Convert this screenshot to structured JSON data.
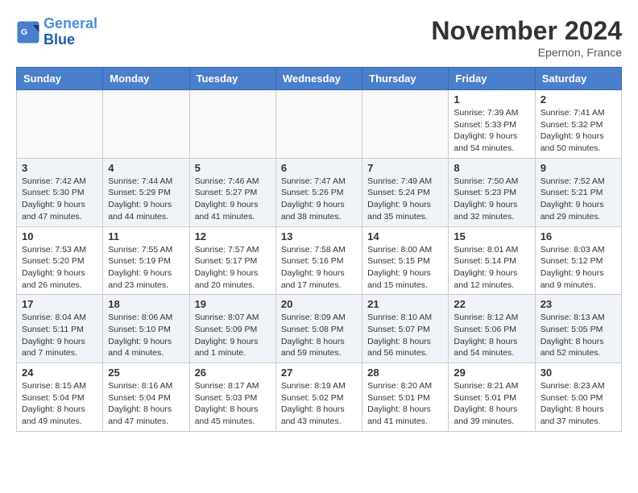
{
  "header": {
    "logo_line1": "General",
    "logo_line2": "Blue",
    "month_title": "November 2024",
    "location": "Epernon, France"
  },
  "weekdays": [
    "Sunday",
    "Monday",
    "Tuesday",
    "Wednesday",
    "Thursday",
    "Friday",
    "Saturday"
  ],
  "weeks": [
    [
      {
        "day": "",
        "sunrise": "",
        "sunset": "",
        "daylight": "",
        "empty": true
      },
      {
        "day": "",
        "sunrise": "",
        "sunset": "",
        "daylight": "",
        "empty": true
      },
      {
        "day": "",
        "sunrise": "",
        "sunset": "",
        "daylight": "",
        "empty": true
      },
      {
        "day": "",
        "sunrise": "",
        "sunset": "",
        "daylight": "",
        "empty": true
      },
      {
        "day": "",
        "sunrise": "",
        "sunset": "",
        "daylight": "",
        "empty": true
      },
      {
        "day": "1",
        "sunrise": "Sunrise: 7:39 AM",
        "sunset": "Sunset: 5:33 PM",
        "daylight": "Daylight: 9 hours and 54 minutes.",
        "empty": false
      },
      {
        "day": "2",
        "sunrise": "Sunrise: 7:41 AM",
        "sunset": "Sunset: 5:32 PM",
        "daylight": "Daylight: 9 hours and 50 minutes.",
        "empty": false
      }
    ],
    [
      {
        "day": "3",
        "sunrise": "Sunrise: 7:42 AM",
        "sunset": "Sunset: 5:30 PM",
        "daylight": "Daylight: 9 hours and 47 minutes.",
        "empty": false
      },
      {
        "day": "4",
        "sunrise": "Sunrise: 7:44 AM",
        "sunset": "Sunset: 5:29 PM",
        "daylight": "Daylight: 9 hours and 44 minutes.",
        "empty": false
      },
      {
        "day": "5",
        "sunrise": "Sunrise: 7:46 AM",
        "sunset": "Sunset: 5:27 PM",
        "daylight": "Daylight: 9 hours and 41 minutes.",
        "empty": false
      },
      {
        "day": "6",
        "sunrise": "Sunrise: 7:47 AM",
        "sunset": "Sunset: 5:26 PM",
        "daylight": "Daylight: 9 hours and 38 minutes.",
        "empty": false
      },
      {
        "day": "7",
        "sunrise": "Sunrise: 7:49 AM",
        "sunset": "Sunset: 5:24 PM",
        "daylight": "Daylight: 9 hours and 35 minutes.",
        "empty": false
      },
      {
        "day": "8",
        "sunrise": "Sunrise: 7:50 AM",
        "sunset": "Sunset: 5:23 PM",
        "daylight": "Daylight: 9 hours and 32 minutes.",
        "empty": false
      },
      {
        "day": "9",
        "sunrise": "Sunrise: 7:52 AM",
        "sunset": "Sunset: 5:21 PM",
        "daylight": "Daylight: 9 hours and 29 minutes.",
        "empty": false
      }
    ],
    [
      {
        "day": "10",
        "sunrise": "Sunrise: 7:53 AM",
        "sunset": "Sunset: 5:20 PM",
        "daylight": "Daylight: 9 hours and 26 minutes.",
        "empty": false
      },
      {
        "day": "11",
        "sunrise": "Sunrise: 7:55 AM",
        "sunset": "Sunset: 5:19 PM",
        "daylight": "Daylight: 9 hours and 23 minutes.",
        "empty": false
      },
      {
        "day": "12",
        "sunrise": "Sunrise: 7:57 AM",
        "sunset": "Sunset: 5:17 PM",
        "daylight": "Daylight: 9 hours and 20 minutes.",
        "empty": false
      },
      {
        "day": "13",
        "sunrise": "Sunrise: 7:58 AM",
        "sunset": "Sunset: 5:16 PM",
        "daylight": "Daylight: 9 hours and 17 minutes.",
        "empty": false
      },
      {
        "day": "14",
        "sunrise": "Sunrise: 8:00 AM",
        "sunset": "Sunset: 5:15 PM",
        "daylight": "Daylight: 9 hours and 15 minutes.",
        "empty": false
      },
      {
        "day": "15",
        "sunrise": "Sunrise: 8:01 AM",
        "sunset": "Sunset: 5:14 PM",
        "daylight": "Daylight: 9 hours and 12 minutes.",
        "empty": false
      },
      {
        "day": "16",
        "sunrise": "Sunrise: 8:03 AM",
        "sunset": "Sunset: 5:12 PM",
        "daylight": "Daylight: 9 hours and 9 minutes.",
        "empty": false
      }
    ],
    [
      {
        "day": "17",
        "sunrise": "Sunrise: 8:04 AM",
        "sunset": "Sunset: 5:11 PM",
        "daylight": "Daylight: 9 hours and 7 minutes.",
        "empty": false
      },
      {
        "day": "18",
        "sunrise": "Sunrise: 8:06 AM",
        "sunset": "Sunset: 5:10 PM",
        "daylight": "Daylight: 9 hours and 4 minutes.",
        "empty": false
      },
      {
        "day": "19",
        "sunrise": "Sunrise: 8:07 AM",
        "sunset": "Sunset: 5:09 PM",
        "daylight": "Daylight: 9 hours and 1 minute.",
        "empty": false
      },
      {
        "day": "20",
        "sunrise": "Sunrise: 8:09 AM",
        "sunset": "Sunset: 5:08 PM",
        "daylight": "Daylight: 8 hours and 59 minutes.",
        "empty": false
      },
      {
        "day": "21",
        "sunrise": "Sunrise: 8:10 AM",
        "sunset": "Sunset: 5:07 PM",
        "daylight": "Daylight: 8 hours and 56 minutes.",
        "empty": false
      },
      {
        "day": "22",
        "sunrise": "Sunrise: 8:12 AM",
        "sunset": "Sunset: 5:06 PM",
        "daylight": "Daylight: 8 hours and 54 minutes.",
        "empty": false
      },
      {
        "day": "23",
        "sunrise": "Sunrise: 8:13 AM",
        "sunset": "Sunset: 5:05 PM",
        "daylight": "Daylight: 8 hours and 52 minutes.",
        "empty": false
      }
    ],
    [
      {
        "day": "24",
        "sunrise": "Sunrise: 8:15 AM",
        "sunset": "Sunset: 5:04 PM",
        "daylight": "Daylight: 8 hours and 49 minutes.",
        "empty": false
      },
      {
        "day": "25",
        "sunrise": "Sunrise: 8:16 AM",
        "sunset": "Sunset: 5:04 PM",
        "daylight": "Daylight: 8 hours and 47 minutes.",
        "empty": false
      },
      {
        "day": "26",
        "sunrise": "Sunrise: 8:17 AM",
        "sunset": "Sunset: 5:03 PM",
        "daylight": "Daylight: 8 hours and 45 minutes.",
        "empty": false
      },
      {
        "day": "27",
        "sunrise": "Sunrise: 8:19 AM",
        "sunset": "Sunset: 5:02 PM",
        "daylight": "Daylight: 8 hours and 43 minutes.",
        "empty": false
      },
      {
        "day": "28",
        "sunrise": "Sunrise: 8:20 AM",
        "sunset": "Sunset: 5:01 PM",
        "daylight": "Daylight: 8 hours and 41 minutes.",
        "empty": false
      },
      {
        "day": "29",
        "sunrise": "Sunrise: 8:21 AM",
        "sunset": "Sunset: 5:01 PM",
        "daylight": "Daylight: 8 hours and 39 minutes.",
        "empty": false
      },
      {
        "day": "30",
        "sunrise": "Sunrise: 8:23 AM",
        "sunset": "Sunset: 5:00 PM",
        "daylight": "Daylight: 8 hours and 37 minutes.",
        "empty": false
      }
    ]
  ]
}
